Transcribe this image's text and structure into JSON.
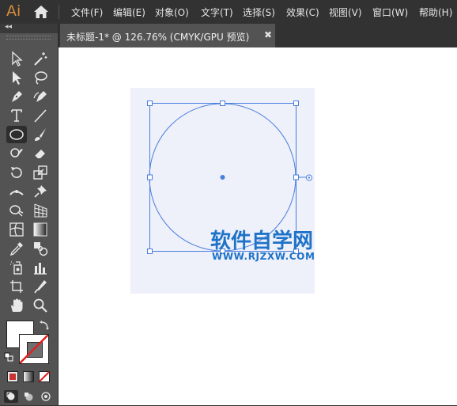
{
  "app": {
    "logo_text": "Ai",
    "brand_color": "#d88b3b"
  },
  "menu": {
    "items": [
      {
        "label": "文件(F)"
      },
      {
        "label": "编辑(E)"
      },
      {
        "label": "对象(O)"
      },
      {
        "label": "文字(T)"
      },
      {
        "label": "选择(S)"
      },
      {
        "label": "效果(C)"
      },
      {
        "label": "视图(V)"
      },
      {
        "label": "窗口(W)"
      },
      {
        "label": "帮助(H)"
      }
    ]
  },
  "toolbar": {
    "collapse_label": "◂◂",
    "active_tool": "ellipse-tool"
  },
  "document": {
    "tab_title": "未标题-1* @ 126.76% (CMYK/GPU 预览)",
    "close_glyph": "✖"
  },
  "canvas": {
    "artboard_color": "#eef0fa",
    "selection_color": "#4a7ede"
  },
  "watermark": {
    "site_name": "软件自学网",
    "url": "WWW.RJZXW.COM",
    "color": "#1e73c8"
  }
}
